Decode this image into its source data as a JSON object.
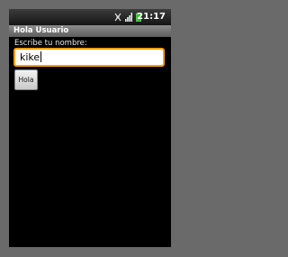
{
  "status_bar": {
    "time": "21:17",
    "icons": [
      "usb-debug-icon",
      "signal-icon",
      "battery-icon"
    ]
  },
  "app": {
    "title": "Hola Usuario"
  },
  "form": {
    "name_label": "Escribe tu nombre:",
    "name_value": "kike",
    "greet_button_label": "Hola"
  },
  "colors": {
    "focus_border": "#ffa000",
    "battery": "#22cc22",
    "screen_bg": "#000000",
    "frame_bg": "#6a6a6a"
  }
}
